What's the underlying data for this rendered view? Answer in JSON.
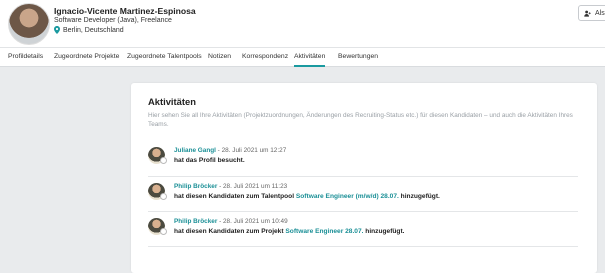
{
  "profile": {
    "name": "Ignacio-Vicente Martinez-Espinosa",
    "role": "Software Developer (Java), Freelance",
    "location": "Berlin, Deutschland"
  },
  "header_button": {
    "label": "Als",
    "icon": "user-plus-icon"
  },
  "tabs": [
    {
      "label": "Profildetails"
    },
    {
      "label": "Zugeordnete Projekte"
    },
    {
      "label": "Zugeordnete Talentpools"
    },
    {
      "label": "Notizen"
    },
    {
      "label": "Korrespondenz"
    },
    {
      "label": "Aktivitäten",
      "active": true
    },
    {
      "label": "Bewertungen"
    }
  ],
  "activities": {
    "title": "Aktivitäten",
    "description": "Hier sehen Sie all Ihre Aktivitäten (Projektzuordnungen, Änderungen des Recruiting-Status etc.) für diesen Kandidaten – und auch die Aktivitäten Ihres Teams.",
    "items": [
      {
        "user": "Juliane Gangl",
        "timestamp": " - 28. Juli 2021 um 12:27",
        "text_before": "hat das Profil besucht.",
        "link": "",
        "text_after": ""
      },
      {
        "user": "Philip Bröcker",
        "timestamp": " - 28. Juli 2021 um 11:23",
        "text_before": "hat diesen Kandidaten zum Talentpool ",
        "link": "Software Engineer (m/w/d) 28.07.",
        "text_after": " hinzugefügt."
      },
      {
        "user": "Philip Bröcker",
        "timestamp": " - 28. Juli 2021 um 10:49",
        "text_before": "hat diesen Kandidaten zum Projekt ",
        "link": "Software Engineer 28.07.",
        "text_after": " hinzugefügt."
      }
    ]
  },
  "colors": {
    "accent": "#1a9aa0",
    "background": "#e9ebed"
  }
}
